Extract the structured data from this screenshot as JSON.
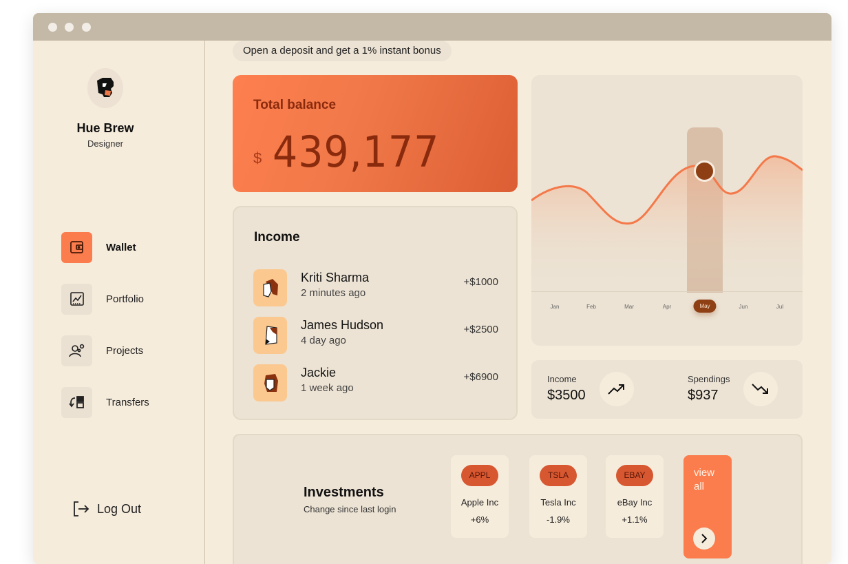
{
  "user": {
    "name": "Hue Brew",
    "role": "Designer"
  },
  "nav": [
    {
      "label": "Wallet",
      "icon": "wallet-icon",
      "active": true
    },
    {
      "label": "Portfolio",
      "icon": "chart-icon",
      "active": false
    },
    {
      "label": "Projects",
      "icon": "user-gear-icon",
      "active": false
    },
    {
      "label": "Transfers",
      "icon": "transfer-icon",
      "active": false
    }
  ],
  "logout": {
    "label": "Log Out"
  },
  "promo": {
    "text": "Open a deposit and get a 1% instant bonus"
  },
  "balance": {
    "title": "Total balance",
    "currency": "$",
    "amount": "439,177"
  },
  "income": {
    "title": "Income",
    "transactions": [
      {
        "name": "Kriti Sharma",
        "time": "2 minutes ago",
        "amount": "+$1000"
      },
      {
        "name": "James Hudson",
        "time": "4 day ago",
        "amount": "+$2500"
      },
      {
        "name": "Jackie",
        "time": "1 week ago",
        "amount": "+$6900"
      }
    ]
  },
  "chart": {
    "months": [
      "Jan",
      "Feb",
      "Mar",
      "Apr",
      "May",
      "Jun",
      "Jul"
    ],
    "selected": "May",
    "accent": "#f4794a"
  },
  "stats": {
    "income_label": "Income",
    "income_value": "$3500",
    "spend_label": "Spendings",
    "spend_value": "$937"
  },
  "investments": {
    "title": "Investments",
    "subtitle": "Change since last login",
    "stocks": [
      {
        "ticker": "APPL",
        "name": "Apple Inc",
        "change": "+6%"
      },
      {
        "ticker": "TSLA",
        "name": "Tesla Inc",
        "change": "-1.9%"
      },
      {
        "ticker": "EBAY",
        "name": "eBay Inc",
        "change": "+1.1%"
      }
    ],
    "view_all": "view all"
  },
  "colors": {
    "accent": "#fb7d4e",
    "background": "#f6ecdc",
    "card": "#ece3d4",
    "dark": "#8e3f14"
  }
}
